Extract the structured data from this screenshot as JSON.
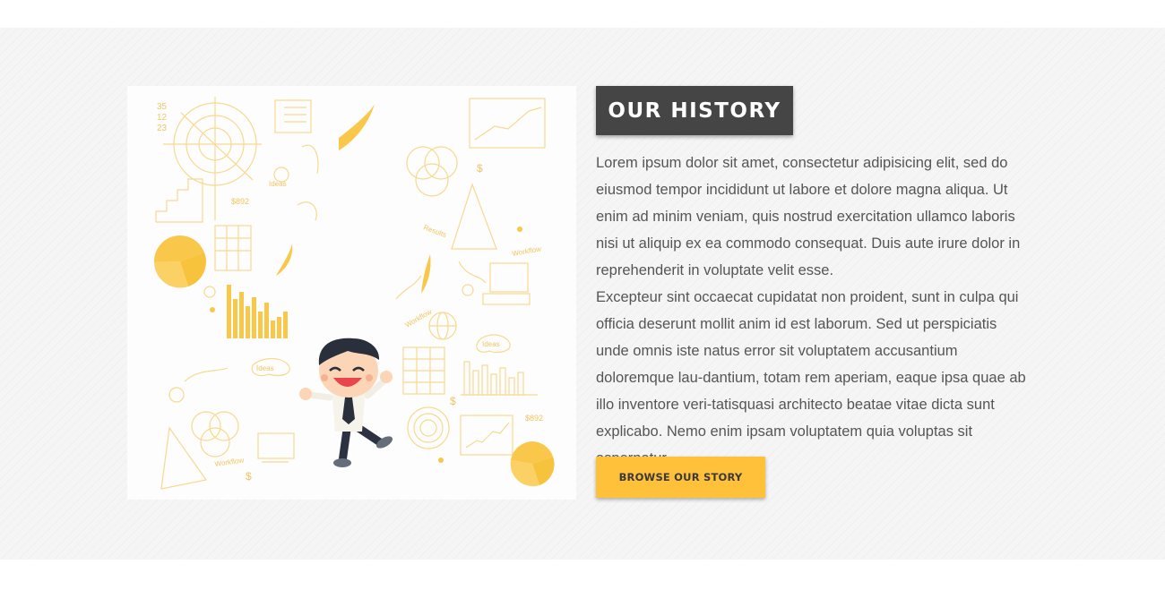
{
  "section": {
    "title": "OUR HISTORY",
    "paragraphs": [
      "Lorem ipsum dolor sit amet, consectetur adipisicing elit, sed do eiusmod tempor incididunt ut labore et dolore magna aliqua. Ut enim ad minim veniam, quis nostrud exercitation ullamco laboris nisi ut aliquip ex ea commodo consequat. Duis aute irure dolor in reprehenderit in voluptate velit esse.",
      "Excepteur sint occaecat cupidatat non proident, sunt in culpa qui officia deserunt mollit anim id est laborum. Sed ut perspiciatis unde omnis iste natus error sit voluptatem accusantium doloremque lau-dantium, totam rem aperiam, eaque ipsa quae ab illo inventore veri-tatisquasi architecto beatae vitae dicta sunt explicabo. Nemo enim ipsam voluptatem quia voluptas sit aspernatur."
    ],
    "button_label": "BROWSE OUR STORY"
  },
  "illustration": {
    "subject": "businessman-with-doodles",
    "accent_color": "#f9c84a",
    "sketch_texts": {
      "numbers": [
        "35",
        "12",
        "23"
      ],
      "price_tags": [
        "$892",
        "$892"
      ],
      "dollar_signs": [
        "$",
        "$",
        "$"
      ],
      "cloud_labels": [
        "Ideas",
        "Ideas",
        "Ideas"
      ],
      "scribbles": [
        "Workflow",
        "Results",
        "Workflow",
        "Workflow"
      ]
    }
  },
  "colors": {
    "title_bg": "#454545",
    "button_bg": "#ffc13a",
    "band_bg": "#f6f5f5",
    "body_text": "#555555"
  }
}
